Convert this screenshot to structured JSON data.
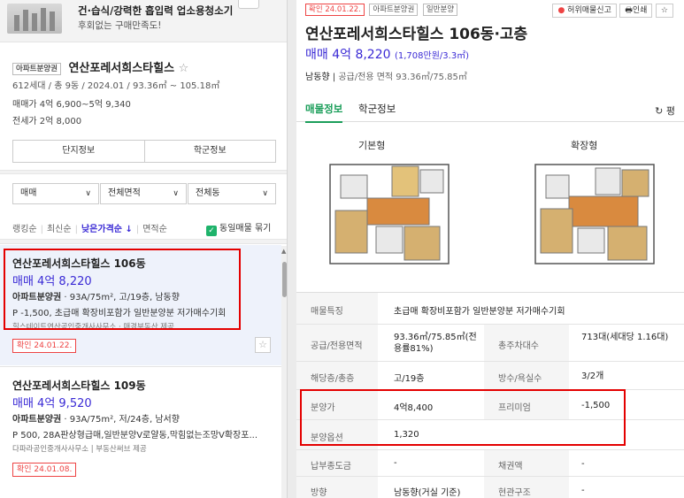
{
  "ad": {
    "title": "건·습식/강력한 흡입력 업소용청소기",
    "subtitle": "후회없는 구매만족도!"
  },
  "complex": {
    "badge": "아파트분양권",
    "name": "연산포레서희스타힐스",
    "star": "☆",
    "info": "612세대 / 총 9동 / 2024.01 / 93.36㎡ ~ 105.18㎡",
    "sale": "매매가 4억 6,900~5억 9,340",
    "lease": "전세가 2억 8,000"
  },
  "tabs": [
    "단지정보",
    "학군정보"
  ],
  "filters": [
    "매매",
    "전체면적",
    "전체동"
  ],
  "sort": {
    "items": [
      "랭킹순",
      "최신순",
      "낮은가격순",
      "면적순"
    ],
    "active": "낮은가격순",
    "arrow": "↓",
    "same_listing": "동일매물 묶기",
    "check": "✓"
  },
  "listings": [
    {
      "name": "연산포레서희스타힐스 106동",
      "price": "매매 4억 8,220",
      "type": "아파트분양권",
      "spec": " · 93A/75m², 고/19층, 남동향",
      "desc": "P -1,500, 초급매 확장비포함가 일반분양분 저가매수기회",
      "agent": "힐스테이트연산공인중개사사무소 · 매경부동산 제공",
      "confirm": "확인 24.01.22."
    },
    {
      "name": "연산포레서희스타힐스 109동",
      "price": "매매 4억 9,520",
      "type": "아파트분양권",
      "spec": " · 93A/75m², 저/24층, 남서향",
      "desc": "P 500, 28A판상형급매,일반분양V로얄동,막힘없는조망V확장포...",
      "agent": "다파라공인중개사사무소 | 부동산써브 제공",
      "confirm": "확인 24.01.08."
    }
  ],
  "detail": {
    "badges": [
      "확인 24.01.22.",
      "아파트분양권",
      "일반분양"
    ],
    "report": "허위매물신고",
    "print": "인쇄",
    "title": "연산포레서희스타힐스 106동·고층",
    "price": "매매 4억 8,220",
    "price_unit": "(1,708만원/3.3㎡)",
    "direction": "남동향",
    "area": "공급/전용 면적 93.36㎡/75.85㎡",
    "tabs": [
      "매물정보",
      "학군정보"
    ],
    "refresh": "평",
    "plan_labels": [
      "기본형",
      "확장형"
    ],
    "rows": [
      {
        "label": "매물특징",
        "value": "초급매 확장비포함가 일반분양분 저가매수기회"
      },
      {
        "label": "공급/전용면적",
        "value": "93.36㎡/75.85㎡(전용률81%)",
        "label2": "총주차대수",
        "value2": "713대(세대당 1.16대)"
      },
      {
        "label": "해당층/총층",
        "value": "고/19층",
        "label2": "방수/욕실수",
        "value2": "3/2개"
      },
      {
        "label": "분양가",
        "value": "4억8,400",
        "label2": "프리미엄",
        "value2": "-1,500"
      },
      {
        "label": "분양옵션",
        "value": "1,320"
      },
      {
        "label": "납부종도금",
        "value": "-",
        "label2": "채권액",
        "value2": "-"
      },
      {
        "label": "방향",
        "value": "남동향(거실 기준)",
        "label2": "현관구조",
        "value2": "-"
      }
    ]
  },
  "icons": {
    "star": "☆",
    "chevron": "∨",
    "refresh": "↻",
    "up": "▲"
  },
  "colors": {
    "price_blue": "#3a2ad5",
    "active_green": "#1b9e5a",
    "highlight_red": "#e40000"
  }
}
